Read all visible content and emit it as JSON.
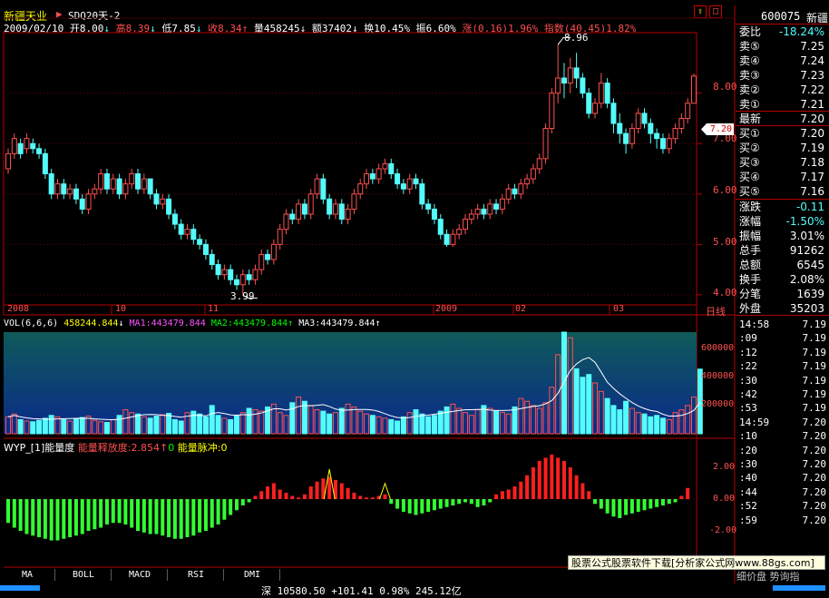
{
  "header": {
    "stock_name": "新疆天业",
    "indicator_name": "SDQ20天-2",
    "date": "2009/02/10",
    "open_label": "开",
    "open": "8.00",
    "open_arrow": "↓",
    "high_label": "高",
    "high": "8.39",
    "high_arrow": "↓",
    "low_label": "低",
    "low": "7.85",
    "low_arrow": "↓",
    "close_label": "收",
    "close": "8.34",
    "close_arrow": "↑",
    "vol_label": "量",
    "vol": "458245",
    "vol_arrow": "↓",
    "amt_label": "额",
    "amt": "37402",
    "amt_arrow": "↓",
    "turn_label": "换",
    "turn": "10.45%",
    "amp_label": "振",
    "amp": "6.60%",
    "chg_label": "涨",
    "chg": "(0.16)1.96%",
    "idx_label": "指数",
    "idx": "(40.45)1.82%"
  },
  "price_axis": [
    "8.00",
    "7.00",
    "6.00",
    "5.00",
    "4.00"
  ],
  "price_marker": "7.20",
  "annotations": {
    "high": "8.96",
    "low": "3.99"
  },
  "time_labels": [
    "2008",
    "10",
    "11",
    "2009",
    "02",
    "03"
  ],
  "period_label": "日线",
  "volume": {
    "title": "VOL(6,6,6)",
    "vol_value": "458244.844",
    "vol_arrow": "↓",
    "ma1": "MA1:443479.844",
    "ma2": "MA2:443479.844",
    "ma2_arrow": "↑",
    "ma3": "MA3:443479.844",
    "ma3_arrow": "↑",
    "axis": [
      "600000",
      "400000",
      "200000"
    ]
  },
  "indicator": {
    "title": "WYP_[1]能量度",
    "release_label": "能量释放度:2.854",
    "release_arrow": "↑",
    "release_tail": "0",
    "pulse_label": "能量脉冲:0",
    "axis": [
      "2.00",
      "0.00",
      "-2.00"
    ]
  },
  "tabs": [
    "MA",
    "BOLL",
    "MACD",
    "RSI",
    "DMI"
  ],
  "banner": "股票公式股票软件下载[分析家公式网www.88gs.com]",
  "bottom_text": "深 10580.50 +101.41 0.98% 245.12亿",
  "bottom_right": "细价盘  势询指",
  "quote": {
    "code": "600075",
    "name": "新疆",
    "weibi_label": "委比",
    "weibi": "-18.24%",
    "sells": [
      {
        "label": "卖⑤",
        "price": "7.25"
      },
      {
        "label": "卖④",
        "price": "7.24"
      },
      {
        "label": "卖③",
        "price": "7.23"
      },
      {
        "label": "卖②",
        "price": "7.22"
      },
      {
        "label": "卖①",
        "price": "7.21"
      }
    ],
    "last_label": "最新",
    "last": "7.20",
    "buys": [
      {
        "label": "买①",
        "price": "7.20"
      },
      {
        "label": "买②",
        "price": "7.19"
      },
      {
        "label": "买③",
        "price": "7.18"
      },
      {
        "label": "买④",
        "price": "7.17"
      },
      {
        "label": "买⑤",
        "price": "7.16"
      }
    ],
    "stats": [
      {
        "label": "涨跌",
        "value": "-0.11"
      },
      {
        "label": "涨幅",
        "value": "-1.50%"
      },
      {
        "label": "振幅",
        "value": "3.01%"
      },
      {
        "label": "总手",
        "value": "91262"
      },
      {
        "label": "总额",
        "value": "6545"
      },
      {
        "label": "换手",
        "value": "2.08%"
      },
      {
        "label": "分笔",
        "value": "1639"
      },
      {
        "label": "外盘",
        "value": "35203"
      }
    ],
    "ticks": [
      {
        "time": "14:58",
        "price": "7.19"
      },
      {
        "time": ":09",
        "price": "7.19"
      },
      {
        "time": ":12",
        "price": "7.19"
      },
      {
        "time": ":22",
        "price": "7.19"
      },
      {
        "time": ":30",
        "price": "7.19"
      },
      {
        "time": ":42",
        "price": "7.19"
      },
      {
        "time": ":53",
        "price": "7.19"
      },
      {
        "time": "14:59",
        "price": "7.20"
      },
      {
        "time": ":10",
        "price": "7.20"
      },
      {
        "time": ":20",
        "price": "7.20"
      },
      {
        "time": ":30",
        "price": "7.20"
      },
      {
        "time": ":40",
        "price": "7.20"
      },
      {
        "time": ":44",
        "price": "7.20"
      },
      {
        "time": ":52",
        "price": "7.20"
      },
      {
        "time": ":59",
        "price": "7.20"
      }
    ]
  },
  "colors": {
    "up": "#ff5050",
    "down": "#54fcfc",
    "axis": "#b40000",
    "bg": "#000000"
  },
  "chart_data": {
    "type": "candlestick",
    "title": "新疆天业",
    "ylim": [
      3.8,
      9.2
    ],
    "candles": [
      [
        6.5,
        6.8,
        6.4,
        6.9
      ],
      [
        6.8,
        7.1,
        6.7,
        7.2
      ],
      [
        7.0,
        6.8,
        6.7,
        7.1
      ],
      [
        6.9,
        7.1,
        6.8,
        7.2
      ],
      [
        7.0,
        6.9,
        6.8,
        7.1
      ],
      [
        6.9,
        6.8,
        6.7,
        7.0
      ],
      [
        6.8,
        6.4,
        6.3,
        6.9
      ],
      [
        6.4,
        6.0,
        5.9,
        6.5
      ],
      [
        6.0,
        6.2,
        5.9,
        6.3
      ],
      [
        6.2,
        6.0,
        5.9,
        6.3
      ],
      [
        6.0,
        6.1,
        5.9,
        6.2
      ],
      [
        6.1,
        5.9,
        5.8,
        6.2
      ],
      [
        5.9,
        5.7,
        5.6,
        6.0
      ],
      [
        5.7,
        6.0,
        5.6,
        6.1
      ],
      [
        6.0,
        6.1,
        5.9,
        6.2
      ],
      [
        6.1,
        6.4,
        6.0,
        6.5
      ],
      [
        6.4,
        6.1,
        6.0,
        6.5
      ],
      [
        6.1,
        6.3,
        6.0,
        6.4
      ],
      [
        6.3,
        6.0,
        5.9,
        6.4
      ],
      [
        6.0,
        6.2,
        5.9,
        6.3
      ],
      [
        6.2,
        6.4,
        6.1,
        6.5
      ],
      [
        6.4,
        6.1,
        6.0,
        6.5
      ],
      [
        6.1,
        6.3,
        6.0,
        6.4
      ],
      [
        6.3,
        6.0,
        5.9,
        6.3
      ],
      [
        6.0,
        5.8,
        5.7,
        6.1
      ],
      [
        5.8,
        5.9,
        5.7,
        6.0
      ],
      [
        5.9,
        5.6,
        5.5,
        6.0
      ],
      [
        5.6,
        5.4,
        5.3,
        5.7
      ],
      [
        5.4,
        5.2,
        5.1,
        5.5
      ],
      [
        5.2,
        5.3,
        5.1,
        5.4
      ],
      [
        5.3,
        5.1,
        5.0,
        5.4
      ],
      [
        5.1,
        5.0,
        4.9,
        5.2
      ],
      [
        5.0,
        4.8,
        4.7,
        5.1
      ],
      [
        4.8,
        4.6,
        4.5,
        4.9
      ],
      [
        4.6,
        4.4,
        4.3,
        4.7
      ],
      [
        4.4,
        4.5,
        4.3,
        4.6
      ],
      [
        4.5,
        4.3,
        4.2,
        4.6
      ],
      [
        4.3,
        4.2,
        4.1,
        4.4
      ],
      [
        4.2,
        4.4,
        3.99,
        4.5
      ],
      [
        4.4,
        4.3,
        4.2,
        4.5
      ],
      [
        4.3,
        4.5,
        4.2,
        4.6
      ],
      [
        4.5,
        4.8,
        4.4,
        4.9
      ],
      [
        4.8,
        4.7,
        4.6,
        4.9
      ],
      [
        4.7,
        5.0,
        4.6,
        5.1
      ],
      [
        5.0,
        5.3,
        4.9,
        5.4
      ],
      [
        5.3,
        5.6,
        5.2,
        5.7
      ],
      [
        5.6,
        5.5,
        5.4,
        5.7
      ],
      [
        5.5,
        5.8,
        5.4,
        5.9
      ],
      [
        5.8,
        5.6,
        5.5,
        5.9
      ],
      [
        5.6,
        6.0,
        5.5,
        6.1
      ],
      [
        6.0,
        6.3,
        5.9,
        6.4
      ],
      [
        6.3,
        5.9,
        5.8,
        6.4
      ],
      [
        5.9,
        5.6,
        5.5,
        6.0
      ],
      [
        5.6,
        5.8,
        5.5,
        5.9
      ],
      [
        5.8,
        5.5,
        5.4,
        5.9
      ],
      [
        5.5,
        5.7,
        5.4,
        5.8
      ],
      [
        5.7,
        6.0,
        5.6,
        6.1
      ],
      [
        6.0,
        6.2,
        5.9,
        6.3
      ],
      [
        6.2,
        6.4,
        6.1,
        6.5
      ],
      [
        6.4,
        6.3,
        6.2,
        6.5
      ],
      [
        6.3,
        6.5,
        6.2,
        6.6
      ],
      [
        6.5,
        6.6,
        6.4,
        6.7
      ],
      [
        6.6,
        6.4,
        6.3,
        6.7
      ],
      [
        6.4,
        6.2,
        6.1,
        6.5
      ],
      [
        6.2,
        6.1,
        6.0,
        6.3
      ],
      [
        6.1,
        6.3,
        6.0,
        6.4
      ],
      [
        6.3,
        6.2,
        6.1,
        6.4
      ],
      [
        6.2,
        5.8,
        5.7,
        6.3
      ],
      [
        5.8,
        5.7,
        5.6,
        5.9
      ],
      [
        5.7,
        5.5,
        5.4,
        5.8
      ],
      [
        5.5,
        5.2,
        5.1,
        5.6
      ],
      [
        5.2,
        5.0,
        4.95,
        5.3
      ],
      [
        5.0,
        5.2,
        4.95,
        5.3
      ],
      [
        5.2,
        5.3,
        5.1,
        5.4
      ],
      [
        5.3,
        5.5,
        5.2,
        5.6
      ],
      [
        5.5,
        5.6,
        5.4,
        5.7
      ],
      [
        5.6,
        5.7,
        5.5,
        5.8
      ],
      [
        5.7,
        5.6,
        5.5,
        5.8
      ],
      [
        5.6,
        5.8,
        5.5,
        5.9
      ],
      [
        5.8,
        5.7,
        5.6,
        5.9
      ],
      [
        5.7,
        5.9,
        5.6,
        6.0
      ],
      [
        5.9,
        6.1,
        5.8,
        6.2
      ],
      [
        6.1,
        6.0,
        5.9,
        6.2
      ],
      [
        6.0,
        6.2,
        5.9,
        6.3
      ],
      [
        6.2,
        6.3,
        6.1,
        6.4
      ],
      [
        6.3,
        6.5,
        6.2,
        6.6
      ],
      [
        6.5,
        6.7,
        6.4,
        6.8
      ],
      [
        6.7,
        7.3,
        6.6,
        7.4
      ],
      [
        7.3,
        8.0,
        7.2,
        8.1
      ],
      [
        8.0,
        8.3,
        7.8,
        8.96
      ],
      [
        8.3,
        8.2,
        7.9,
        8.6
      ],
      [
        8.2,
        8.5,
        8.0,
        8.7
      ],
      [
        8.5,
        8.3,
        8.1,
        8.8
      ],
      [
        8.3,
        8.0,
        7.9,
        8.4
      ],
      [
        8.0,
        7.6,
        7.5,
        8.1
      ],
      [
        7.6,
        7.8,
        7.5,
        7.9
      ],
      [
        7.8,
        8.2,
        7.7,
        8.4
      ],
      [
        8.2,
        7.8,
        7.7,
        8.3
      ],
      [
        7.8,
        7.4,
        7.2,
        7.9
      ],
      [
        7.4,
        7.2,
        7.0,
        7.6
      ],
      [
        7.2,
        7.0,
        6.8,
        7.3
      ],
      [
        7.0,
        7.3,
        6.9,
        7.4
      ],
      [
        7.3,
        7.6,
        7.2,
        7.7
      ],
      [
        7.6,
        7.4,
        7.3,
        7.7
      ],
      [
        7.4,
        7.2,
        7.0,
        7.5
      ],
      [
        7.2,
        7.1,
        6.9,
        7.3
      ],
      [
        7.1,
        6.9,
        6.8,
        7.2
      ],
      [
        6.9,
        7.1,
        6.8,
        7.2
      ],
      [
        7.1,
        7.3,
        7.0,
        7.4
      ],
      [
        7.3,
        7.5,
        7.2,
        7.6
      ],
      [
        7.5,
        7.8,
        7.4,
        7.9
      ],
      [
        7.8,
        8.34,
        7.85,
        8.39
      ]
    ],
    "volume": [
      120,
      140,
      100,
      90,
      85,
      95,
      110,
      130,
      120,
      100,
      90,
      105,
      115,
      125,
      95,
      85,
      80,
      100,
      130,
      170,
      150,
      140,
      120,
      110,
      125,
      135,
      145,
      100,
      90,
      150,
      160,
      140,
      120,
      200,
      130,
      110,
      100,
      125,
      150,
      180,
      170,
      160,
      190,
      210,
      150,
      130,
      220,
      260,
      230,
      200,
      170,
      160,
      140,
      150,
      180,
      210,
      190,
      160,
      140,
      130,
      120,
      110,
      100,
      90,
      120,
      150,
      170,
      140,
      120,
      130,
      160,
      190,
      210,
      180,
      150,
      130,
      170,
      200,
      180,
      160,
      150,
      140,
      190,
      250,
      230,
      200,
      180,
      220,
      330,
      560,
      720,
      680,
      460,
      400,
      420,
      360,
      300,
      250,
      200,
      170,
      230,
      180,
      150,
      140,
      120,
      130,
      110,
      100,
      150,
      170,
      200,
      260,
      458
    ],
    "energy": [
      -1.5,
      -1.8,
      -2.0,
      -2.2,
      -2.3,
      -2.4,
      -2.5,
      -2.6,
      -2.6,
      -2.5,
      -2.4,
      -2.3,
      -2.2,
      -2.0,
      -1.9,
      -1.8,
      -1.6,
      -1.5,
      -1.5,
      -1.6,
      -1.8,
      -2.0,
      -2.1,
      -2.2,
      -2.2,
      -2.3,
      -2.4,
      -2.5,
      -2.5,
      -2.4,
      -2.3,
      -2.1,
      -2.0,
      -1.8,
      -1.6,
      -1.3,
      -1.0,
      -0.7,
      -0.4,
      -0.2,
      0.2,
      0.5,
      0.8,
      1.0,
      0.6,
      0.4,
      0.2,
      0.1,
      0.3,
      0.8,
      1.1,
      1.3,
      1.4,
      1.2,
      1.0,
      0.7,
      0.4,
      0.2,
      0.1,
      0.1,
      0.2,
      0.3,
      -0.3,
      -0.6,
      -0.8,
      -0.9,
      -1.0,
      -0.9,
      -0.8,
      -0.7,
      -0.6,
      -0.5,
      -0.4,
      -0.3,
      -0.2,
      -0.3,
      -0.5,
      -0.4,
      -0.2,
      0.3,
      0.5,
      0.6,
      0.8,
      1.1,
      1.5,
      2.0,
      2.4,
      2.6,
      2.8,
      2.6,
      2.4,
      2.0,
      1.5,
      1.0,
      0.5,
      -0.3,
      -0.6,
      -0.9,
      -1.1,
      -1.2,
      -1.0,
      -0.9,
      -0.8,
      -0.7,
      -0.6,
      -0.5,
      -0.4,
      -0.3,
      -0.2,
      0.2,
      0.7
    ]
  }
}
